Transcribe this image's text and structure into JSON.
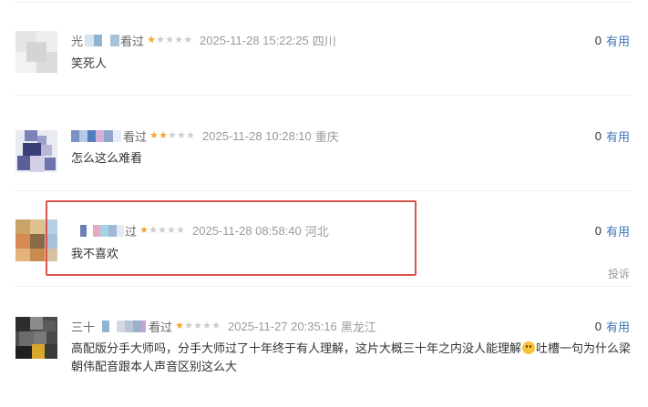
{
  "comments": [
    {
      "action": "看过",
      "rating": 1,
      "time": "2025-11-28 15:22:25",
      "location": "四川",
      "useful_count": "0",
      "useful_label": "有用",
      "content": "笑死人",
      "username_prefix": "光"
    },
    {
      "action": "看过",
      "rating": 2,
      "time": "2025-11-28 10:28:10",
      "location": "重庆",
      "useful_count": "0",
      "useful_label": "有用",
      "content": "怎么这么难看"
    },
    {
      "action": "过",
      "rating": 1,
      "time": "2025-11-28 08:58:40",
      "location": "河北",
      "useful_count": "0",
      "useful_label": "有用",
      "content": "我不喜欢",
      "complain": "投诉"
    },
    {
      "action": "看过",
      "rating": 1,
      "time": "2025-11-27 20:35:16",
      "location": "黑龙江",
      "useful_count": "0",
      "useful_label": "有用",
      "content_part1": "高配版分手大师吗，分手大师过了十年终于有人理解，这片大概三十年之内没人能理解",
      "content_part2": "吐槽一句为什么梁朝伟配音跟本人声音区别这么大",
      "emoji": "grinning-sweat-emoji",
      "username_prefix": "三十"
    }
  ],
  "colors": {
    "star_on": "#f3a533",
    "star_off": "#cccccc",
    "useful_link": "#3d76b5",
    "highlight_border": "#d9534f"
  }
}
